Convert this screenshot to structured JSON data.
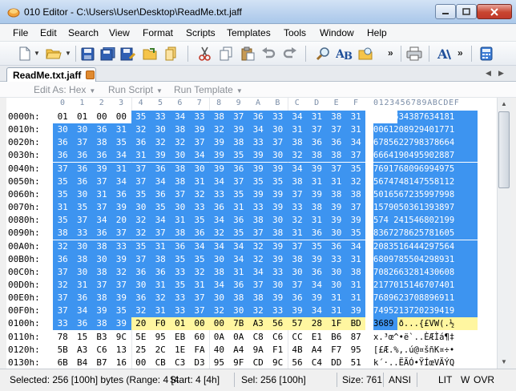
{
  "window": {
    "title": "010 Editor - C:\\Users\\User\\Desktop\\ReadMe.txt.jaff",
    "icon": "app-logo-icon"
  },
  "menu": [
    "File",
    "Edit",
    "Search",
    "View",
    "Format",
    "Scripts",
    "Templates",
    "Tools",
    "Window",
    "Help"
  ],
  "toolbar": {
    "buttons": [
      "new-file-icon",
      "open-file-icon",
      "save-icon",
      "save-all-icon",
      "save-as-icon",
      "open-folder-icon",
      "copy-file-icon",
      "cut-icon",
      "copy-icon",
      "paste-icon",
      "undo-icon",
      "redo-icon",
      "find-icon",
      "find-replace-icon",
      "goto-icon",
      "print-icon",
      "compare-icon",
      "font-icon",
      "calculator-icon"
    ],
    "more": "»"
  },
  "tab": {
    "label": "ReadMe.txt.jaff"
  },
  "options": {
    "edit_as": "Edit As: Hex",
    "run_script": "Run Script",
    "run_template": "Run Template"
  },
  "hex": {
    "col_headers": [
      "0",
      "1",
      "2",
      "3",
      "4",
      "5",
      "6",
      "7",
      "8",
      "9",
      "A",
      "B",
      "C",
      "D",
      "E",
      "F"
    ],
    "ascii_header": "0123456789ABCDEF",
    "rows": [
      {
        "addr": "0000h:",
        "bytes": [
          "01",
          "01",
          "00",
          "00",
          "35",
          "33",
          "34",
          "33",
          "38",
          "37",
          "36",
          "33",
          "34",
          "31",
          "38",
          "31"
        ],
        "ascii": "....534387634181"
      },
      {
        "addr": "0010h:",
        "bytes": [
          "30",
          "30",
          "36",
          "31",
          "32",
          "30",
          "38",
          "39",
          "32",
          "39",
          "34",
          "30",
          "31",
          "37",
          "37",
          "31"
        ],
        "ascii": "0061208929401771"
      },
      {
        "addr": "0020h:",
        "bytes": [
          "36",
          "37",
          "38",
          "35",
          "36",
          "32",
          "32",
          "37",
          "39",
          "38",
          "33",
          "37",
          "38",
          "36",
          "36",
          "34"
        ],
        "ascii": "6785622798378664"
      },
      {
        "addr": "0030h:",
        "bytes": [
          "36",
          "36",
          "36",
          "34",
          "31",
          "39",
          "30",
          "34",
          "39",
          "35",
          "39",
          "30",
          "32",
          "38",
          "38",
          "37"
        ],
        "ascii": "6664190495902887"
      },
      {
        "addr": "0040h:",
        "bytes": [
          "37",
          "36",
          "39",
          "31",
          "37",
          "36",
          "38",
          "30",
          "39",
          "36",
          "39",
          "39",
          "34",
          "39",
          "37",
          "35"
        ],
        "ascii": "7691768096994975"
      },
      {
        "addr": "0050h:",
        "bytes": [
          "35",
          "36",
          "37",
          "34",
          "37",
          "34",
          "38",
          "31",
          "34",
          "37",
          "35",
          "35",
          "38",
          "31",
          "31",
          "32"
        ],
        "ascii": "5674748147558112"
      },
      {
        "addr": "0060h:",
        "bytes": [
          "35",
          "30",
          "31",
          "36",
          "35",
          "36",
          "37",
          "32",
          "33",
          "35",
          "39",
          "39",
          "37",
          "39",
          "38",
          "38"
        ],
        "ascii": "5016567235997998"
      },
      {
        "addr": "0070h:",
        "bytes": [
          "31",
          "35",
          "37",
          "39",
          "30",
          "35",
          "30",
          "33",
          "36",
          "31",
          "33",
          "39",
          "33",
          "38",
          "39",
          "37"
        ],
        "ascii": "1579050361393897"
      },
      {
        "addr": "0080h:",
        "bytes": [
          "35",
          "37",
          "34",
          "20",
          "32",
          "34",
          "31",
          "35",
          "34",
          "36",
          "38",
          "30",
          "32",
          "31",
          "39",
          "39"
        ],
        "ascii": "574 241546802199"
      },
      {
        "addr": "0090h:",
        "bytes": [
          "38",
          "33",
          "36",
          "37",
          "32",
          "37",
          "38",
          "36",
          "32",
          "35",
          "37",
          "38",
          "31",
          "36",
          "30",
          "35"
        ],
        "ascii": "8367278625781605"
      },
      {
        "addr": "00A0h:",
        "bytes": [
          "32",
          "30",
          "38",
          "33",
          "35",
          "31",
          "36",
          "34",
          "34",
          "34",
          "32",
          "39",
          "37",
          "35",
          "36",
          "34"
        ],
        "ascii": "2083516444297564"
      },
      {
        "addr": "00B0h:",
        "bytes": [
          "36",
          "38",
          "30",
          "39",
          "37",
          "38",
          "35",
          "35",
          "30",
          "34",
          "32",
          "39",
          "38",
          "39",
          "33",
          "31"
        ],
        "ascii": "6809785504298931"
      },
      {
        "addr": "00C0h:",
        "bytes": [
          "37",
          "30",
          "38",
          "32",
          "36",
          "36",
          "33",
          "32",
          "38",
          "31",
          "34",
          "33",
          "30",
          "36",
          "30",
          "38"
        ],
        "ascii": "7082663281430608"
      },
      {
        "addr": "00D0h:",
        "bytes": [
          "32",
          "31",
          "37",
          "37",
          "30",
          "31",
          "35",
          "31",
          "34",
          "36",
          "37",
          "30",
          "37",
          "34",
          "30",
          "31"
        ],
        "ascii": "2177015146707401"
      },
      {
        "addr": "00E0h:",
        "bytes": [
          "37",
          "36",
          "38",
          "39",
          "36",
          "32",
          "33",
          "37",
          "30",
          "38",
          "38",
          "39",
          "36",
          "39",
          "31",
          "31"
        ],
        "ascii": "7689623708896911"
      },
      {
        "addr": "00F0h:",
        "bytes": [
          "37",
          "34",
          "39",
          "35",
          "32",
          "31",
          "33",
          "37",
          "32",
          "30",
          "32",
          "33",
          "39",
          "34",
          "31",
          "39"
        ],
        "ascii": "7495213720239419"
      },
      {
        "addr": "0100h:",
        "bytes": [
          "33",
          "36",
          "38",
          "39",
          "20",
          "F0",
          "01",
          "00",
          "00",
          "7B",
          "A3",
          "56",
          "57",
          "28",
          "1F",
          "BD"
        ],
        "ascii": "3689 ð...{£VW(.½"
      },
      {
        "addr": "0110h:",
        "bytes": [
          "78",
          "15",
          "B3",
          "9C",
          "5E",
          "95",
          "EB",
          "60",
          "0A",
          "0A",
          "C8",
          "C6",
          "CC",
          "E1",
          "B6",
          "87"
        ],
        "ascii": "x.³œ^•ë`..ÈÆÌá¶‡"
      },
      {
        "addr": "0120h:",
        "bytes": [
          "5B",
          "A3",
          "C6",
          "13",
          "25",
          "2C",
          "1E",
          "FA",
          "40",
          "A4",
          "9A",
          "F1",
          "4B",
          "A4",
          "F7",
          "95"
        ],
        "ascii": "[£Æ.%,.ú@¤šñK¤÷•"
      },
      {
        "addr": "0130h:",
        "bytes": [
          "6B",
          "B4",
          "B7",
          "16",
          "00",
          "CB",
          "C3",
          "D3",
          "95",
          "9F",
          "CD",
          "9C",
          "56",
          "C4",
          "DD",
          "51"
        ],
        "ascii": "k´·..ËÃÓ•ŸÍœVÄÝQ"
      }
    ]
  },
  "status": {
    "selected": "Selected: 256 [100h] bytes (Range: 4 [4",
    "start": "Start: 4 [4h]",
    "sel": "Sel: 256 [100h]",
    "size": "Size: 761",
    "encoding": "ANSI",
    "lit": "LIT",
    "w": "W",
    "ovr": "OVR"
  }
}
